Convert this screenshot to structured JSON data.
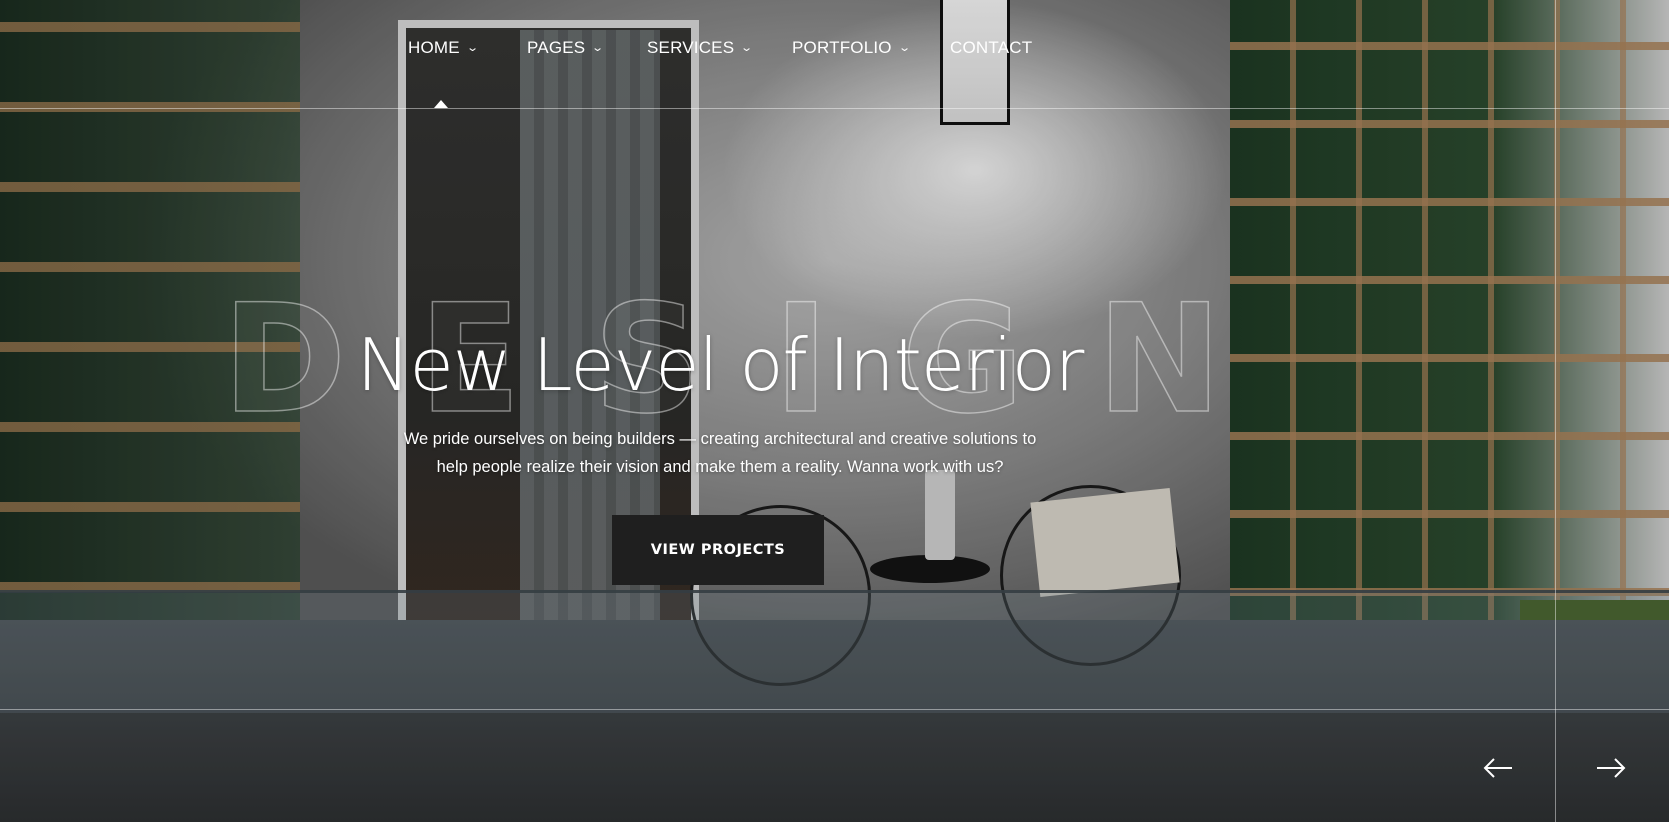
{
  "nav": {
    "items": [
      {
        "label": "HOME",
        "active": true
      },
      {
        "label": "PAGES",
        "active": false
      },
      {
        "label": "SERVICES",
        "active": false
      },
      {
        "label": "PORTFOLIO",
        "active": false
      },
      {
        "label": "CONTACT",
        "active": false
      }
    ],
    "caret_icon": "chevron-down-icon"
  },
  "hero": {
    "background_word": [
      "D",
      "E",
      "S",
      "I",
      "G",
      "N"
    ],
    "title": "New Level of Interior",
    "subtitle_line1": "We pride ourselves on being builders — creating architectural and creative solutions to",
    "subtitle_line2": "help people realize their vision and make them a reality. Wanna work with us?",
    "cta_label": "VIEW PROJECTS"
  },
  "slider": {
    "prev_icon": "arrow-left-icon",
    "next_icon": "arrow-right-icon"
  },
  "colors": {
    "cta_background": "#1f1f1f",
    "text": "#ffffff"
  }
}
